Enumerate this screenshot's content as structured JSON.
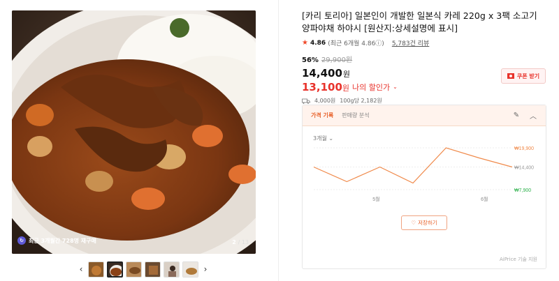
{
  "gallery": {
    "repurchase_text": "최근 3개월간 728명 재구매",
    "current": "2",
    "total": "/ 13"
  },
  "product": {
    "title": "[카리 토리아] 일본인이 개발한 일본식 카레 220g x 3팩 소고기 양파야채 하야시 [원산지:상세설명에 표시]",
    "rating": "4.86",
    "rating_sub": "(최근 6개월 4.86ⓘ)",
    "reviews": "5,783건 리뷰",
    "discount": "56%",
    "original_price": "29,900원",
    "sale_price": "14,400",
    "won": "원",
    "my_price": "13,100",
    "my_price_won": "원",
    "my_price_label": "나의 할인가",
    "shipping": "4,000원",
    "unit_price": "100g당 2,182원",
    "coupon": "쿠폰 받기"
  },
  "price_card": {
    "tabs": [
      "가격 기록",
      "판매량 분석"
    ],
    "period": "3개월",
    "save_label": "저장하기",
    "credit": "AiPrice 기술 지원",
    "accent": "#f08a4b"
  },
  "chart_data": {
    "type": "line",
    "x_tick_labels": [
      "5월",
      "6월"
    ],
    "y_tick_labels": [
      "₩19,900",
      "₩14,400",
      "₩7,900"
    ],
    "y_tick_values": [
      19900,
      14400,
      7900
    ],
    "ylim": [
      7900,
      19900
    ],
    "series": [
      {
        "values": [
          14400,
          10200,
          14400,
          9800,
          19900,
          17000,
          14400
        ]
      }
    ]
  }
}
